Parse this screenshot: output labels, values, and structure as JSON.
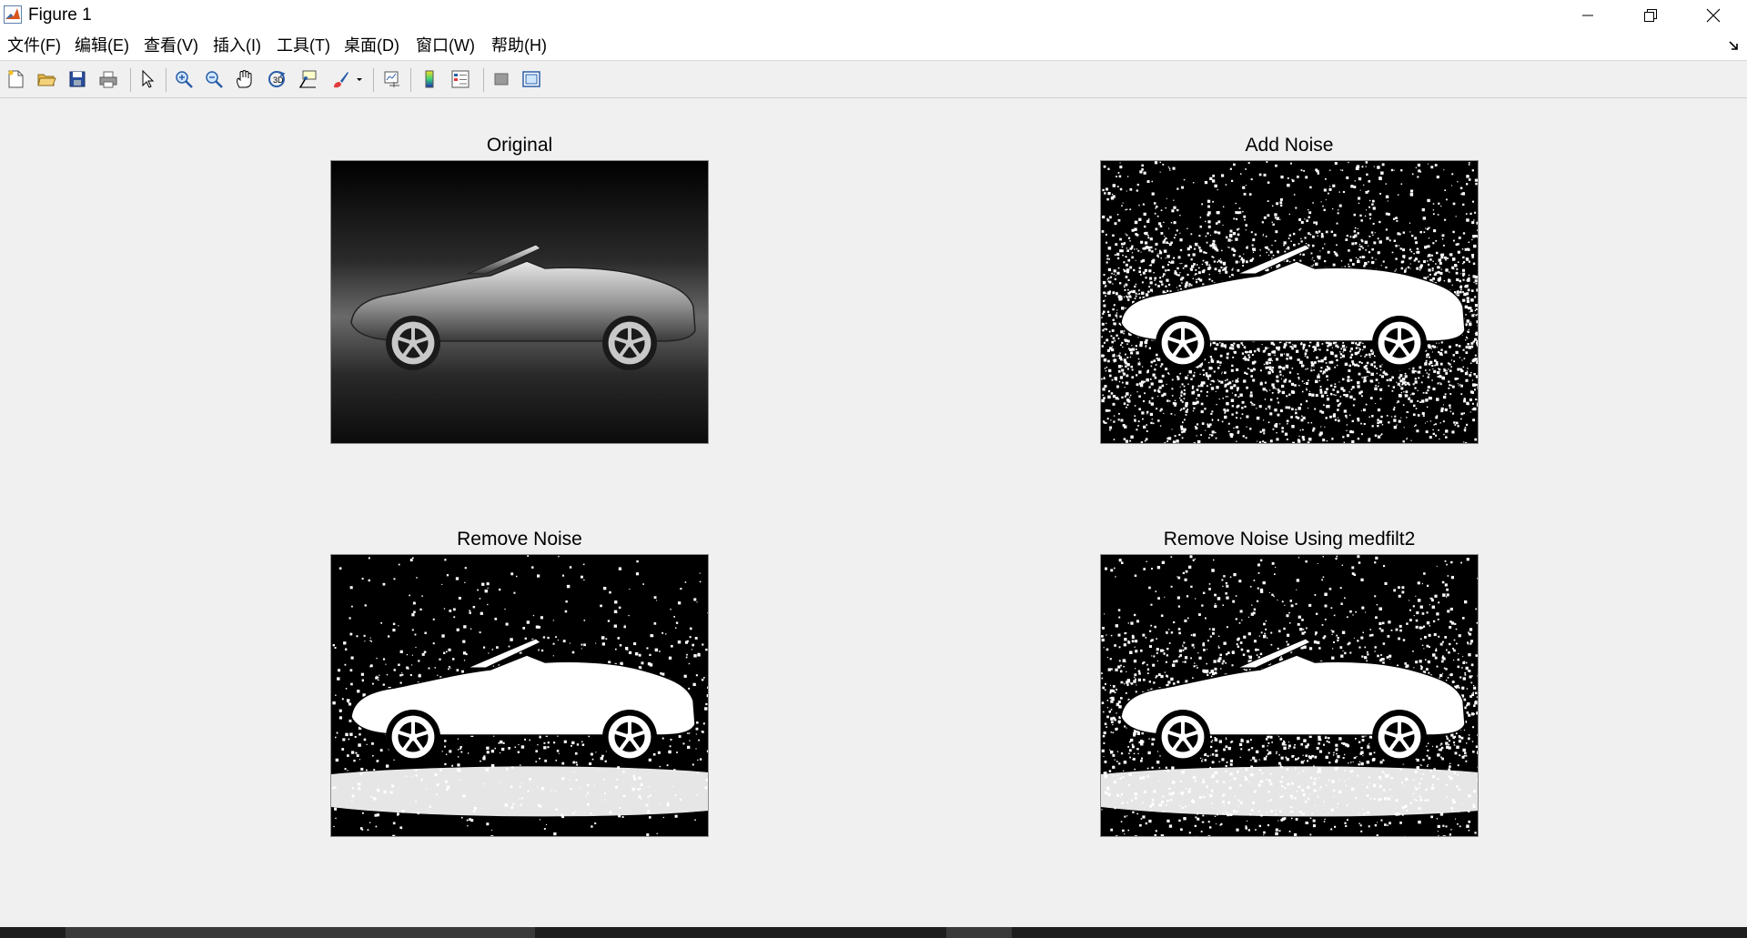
{
  "window": {
    "title": "Figure 1"
  },
  "menu": [
    "文件(F)",
    "编辑(E)",
    "查看(V)",
    "插入(I)",
    "工具(T)",
    "桌面(D)",
    "窗口(W)",
    "帮助(H)"
  ],
  "toolbar_icons": [
    "new-figure-icon",
    "open-file-icon",
    "save-icon",
    "print-icon",
    "select-arrow-icon",
    "zoom-in-icon",
    "zoom-out-icon",
    "pan-hand-icon",
    "rotate-3d-icon",
    "data-cursor-icon",
    "brush-icon",
    "brush-dropdown-icon",
    "link-plot-icon",
    "colorbar-icon",
    "legend-icon",
    "hide-plot-tools-icon",
    "show-plot-tools-icon"
  ],
  "panels": [
    {
      "title": "Original"
    },
    {
      "title": "Add Noise"
    },
    {
      "title": "Remove Noise"
    },
    {
      "title": "Remove Noise Using medfilt2"
    }
  ],
  "colors": {
    "window_bg": "#f0f0f0",
    "titlebar_bg": "#ffffff",
    "image_bg": "#000000"
  }
}
